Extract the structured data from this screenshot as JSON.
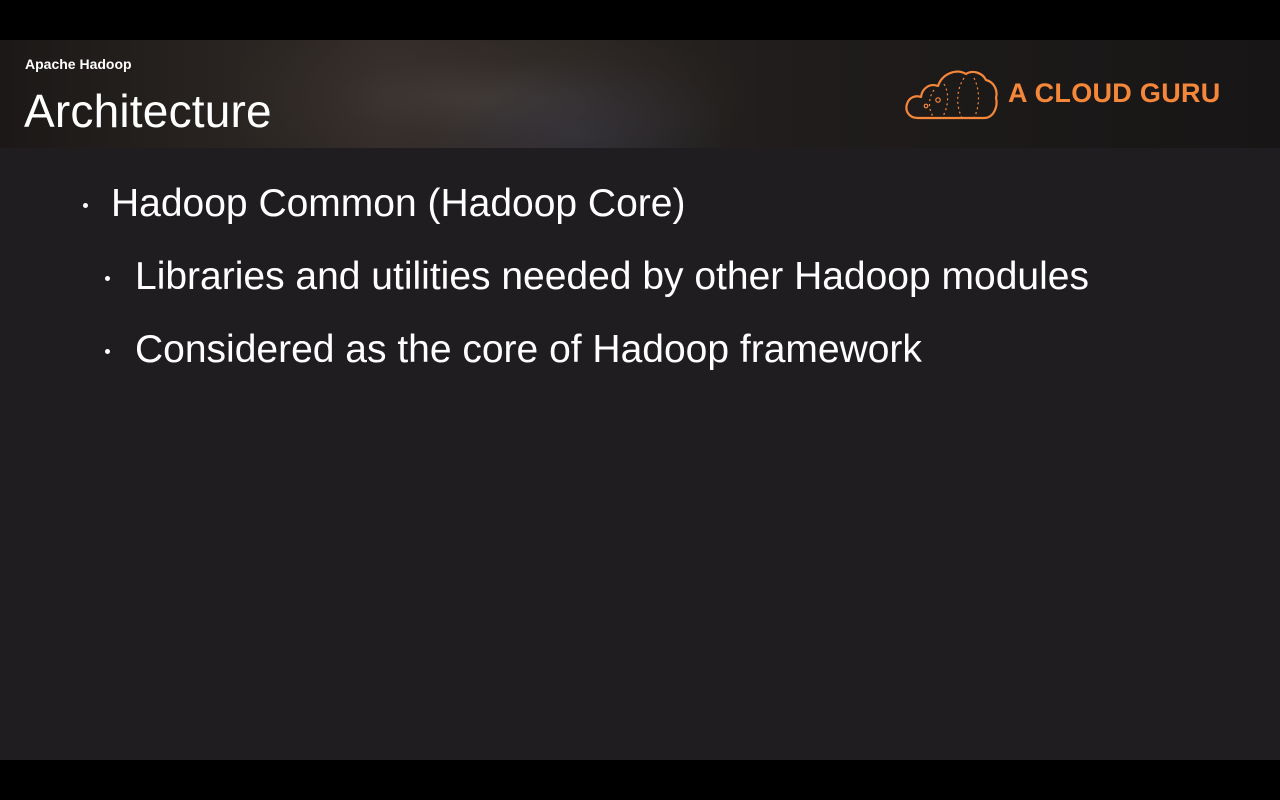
{
  "header": {
    "kicker": "Apache Hadoop",
    "title": "Architecture"
  },
  "logo": {
    "text": "A CLOUD GURU",
    "icon": "cloud-icon",
    "color": "#f5873a"
  },
  "bullets": [
    {
      "level": 1,
      "text": "Hadoop Common (Hadoop Core)"
    },
    {
      "level": 2,
      "text": "Libraries and utilities needed by other Hadoop modules"
    },
    {
      "level": 2,
      "text": "Considered as the core of Hadoop framework"
    }
  ],
  "colors": {
    "slide_background": "#1f1d20",
    "text": "#ffffff",
    "accent": "#f5873a"
  }
}
